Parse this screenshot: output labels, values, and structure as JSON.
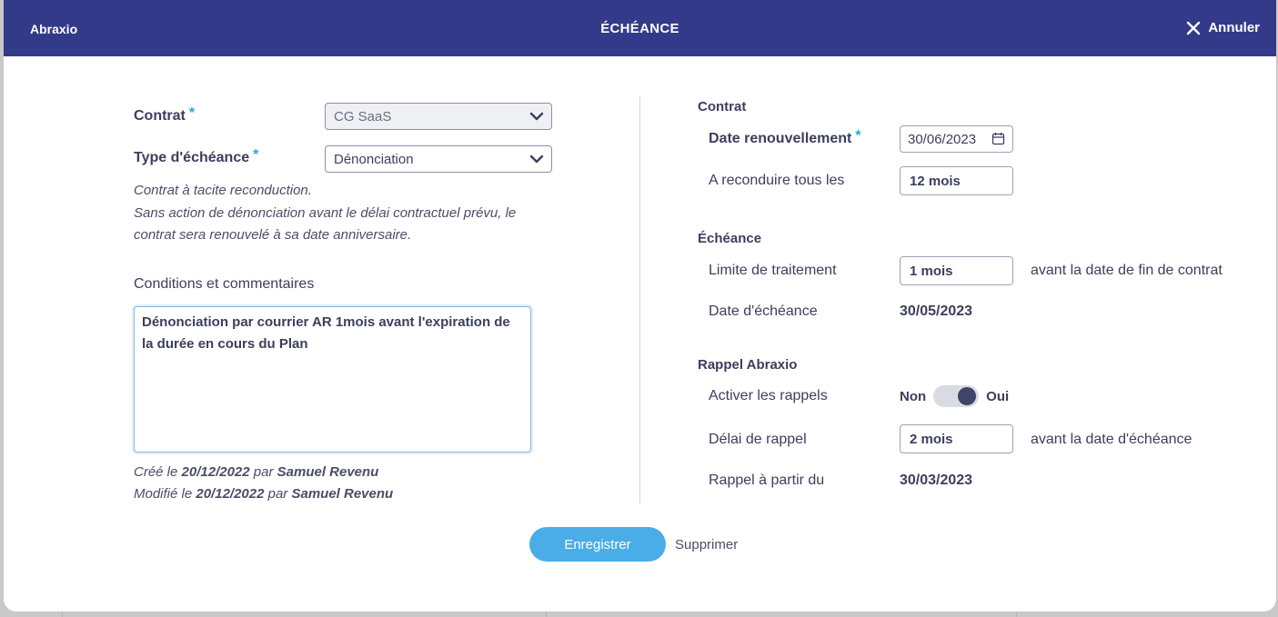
{
  "header": {
    "brand": "Abraxio",
    "title": "ÉCHÉANCE",
    "cancel_label": "Annuler",
    "color": "#333a8a"
  },
  "left": {
    "contract_label": "Contrat",
    "contract_value": "CG SaaS",
    "type_label": "Type d'échéance",
    "type_value": "Dénonciation",
    "required_mark": "*",
    "note_line1": "Contrat à tacite reconduction.",
    "note_line2": "Sans action de dénonciation avant le délai contractuel prévu, le",
    "note_line3": "contrat sera renouvelé à sa date anniversaire.",
    "comments_label": "Conditions et commentaires",
    "comments_value": "Dénonciation par courrier AR 1mois avant l'expiration de la durée en cours du Plan",
    "created_prefix": "Créé le",
    "created_date": "20/12/2022",
    "created_by": "par",
    "created_user": "Samuel Revenu",
    "modified_prefix": "Modifié le",
    "modified_date": "20/12/2022",
    "modified_by": "par",
    "modified_user": "Samuel Revenu"
  },
  "right": {
    "contract_section": "Contrat",
    "renewal_label": "Date renouvellement",
    "renewal_value": "30/06/2023",
    "renew_every_label": "A reconduire tous les",
    "renew_every_value": "12 mois",
    "deadline_section": "Échéance",
    "processing_limit_label": "Limite de traitement",
    "processing_limit_value": "1 mois",
    "processing_limit_suffix": "avant la date de fin de contrat",
    "due_date_label": "Date d'échéance",
    "due_date_value": "30/05/2023",
    "reminder_section": "Rappel Abraxio",
    "activate_label": "Activer les rappels",
    "toggle_off": "Non",
    "toggle_on": "Oui",
    "toggle_state": "on",
    "reminder_delay_label": "Délai de rappel",
    "reminder_delay_value": "2 mois",
    "reminder_delay_suffix": "avant la date d'échéance",
    "reminder_from_label": "Rappel à partir du",
    "reminder_from_value": "30/03/2023"
  },
  "actions": {
    "save_label": "Enregistrer",
    "delete_label": "Supprimer",
    "save_color": "#4aade8"
  }
}
